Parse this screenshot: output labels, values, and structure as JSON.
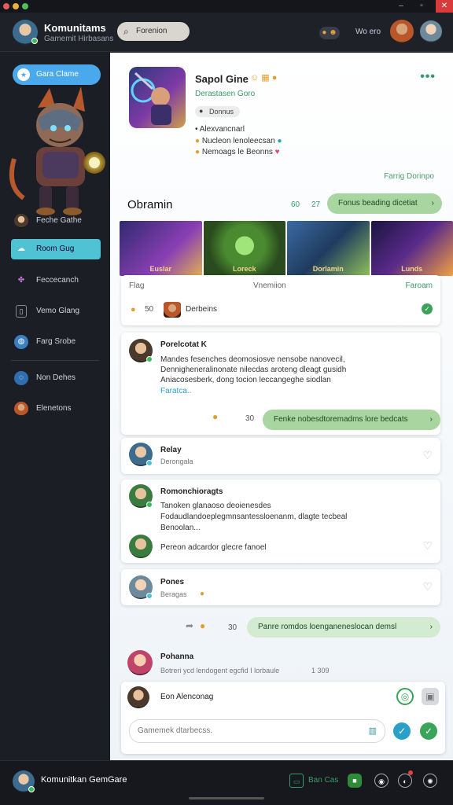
{
  "header": {
    "brand_title": "Komunitams",
    "brand_sub": "Gamemit Hirbasans",
    "search_label": "Forenion",
    "user_label": "Wo ero"
  },
  "sidebar": {
    "primary": "Gara Clame",
    "items": [
      {
        "label": "Feche Gathe",
        "icon": "user-icon"
      },
      {
        "label": "Room Gug",
        "icon": "cloud-icon"
      },
      {
        "label": "Feccecanch",
        "icon": "gamepad-icon"
      },
      {
        "label": "Vemo Glang",
        "icon": "book-icon"
      },
      {
        "label": "Farg Srobe",
        "icon": "globe-icon"
      },
      {
        "label": "Non Dehes",
        "icon": "chat-icon"
      },
      {
        "label": "Elenetons",
        "icon": "user-icon"
      }
    ]
  },
  "profile": {
    "name": "Sapol Gine",
    "subtitle": "Derastasen Goro",
    "chip": "Donnus",
    "lines": [
      "Alexvancnarl",
      "Nucleon lenoleecsan",
      "Nemoags le Beonns"
    ]
  },
  "links": {
    "right_link": "Farrig Dorinpo"
  },
  "section": {
    "title": "Obramin",
    "num_a": "60",
    "num_b": "27",
    "pill": "Fonus beading dicetiat"
  },
  "gallery": [
    {
      "label": "Euslar"
    },
    {
      "label": "Loreck"
    },
    {
      "label": "Dorlamin"
    },
    {
      "label": "Lunds"
    }
  ],
  "filter_card": {
    "col_a": "Flag",
    "col_b": "Vnemiion",
    "col_c": "Faroam",
    "count": "50",
    "item": "Derbeins"
  },
  "post1": {
    "name": "Porelcotat K",
    "lines": [
      "Mandes fesenches deomosiosve nensobe nanovecil,",
      "Dennigheneralinonate nilecdas aroteng dleagt gusidh",
      "Aniacosesberk, dong tocion leccangeghe siodlan"
    ],
    "link": "Faratca..",
    "meta": "30",
    "pill": "Fenke nobesdtoremadms lore bedcats"
  },
  "post2": {
    "name": "Relay",
    "sub": "Derongala"
  },
  "post3": {
    "name": "Romonchioragts",
    "line1": "Tanoken glanaoso deoienesdes",
    "line2": "Fodaudlandoeplegmnsantessloenanm, dlagte tecbeal",
    "line3": "Benoolan...",
    "reply": "Pereon adcardor glecre fanoel"
  },
  "post4": {
    "name": "Pones",
    "sub": "Beragas"
  },
  "reply_row": {
    "meta": "30",
    "pill": "Panre romdos loenganeneslocan demsl"
  },
  "post5": {
    "name": "Pohanna",
    "sub": "Botreri ycd lendogent egcfid I lorbaule",
    "count": "1 309"
  },
  "composer": {
    "title": "Eon Alenconag",
    "placeholder": "Gamemek dtarbecss."
  },
  "footer": {
    "brand": "Komunitkan GemGare",
    "label": "Ban Cas"
  },
  "colors": {
    "accent": "#4aa8ec",
    "sidebar_active": "#4fc3d4",
    "green_pill": "#a8d5a0"
  }
}
